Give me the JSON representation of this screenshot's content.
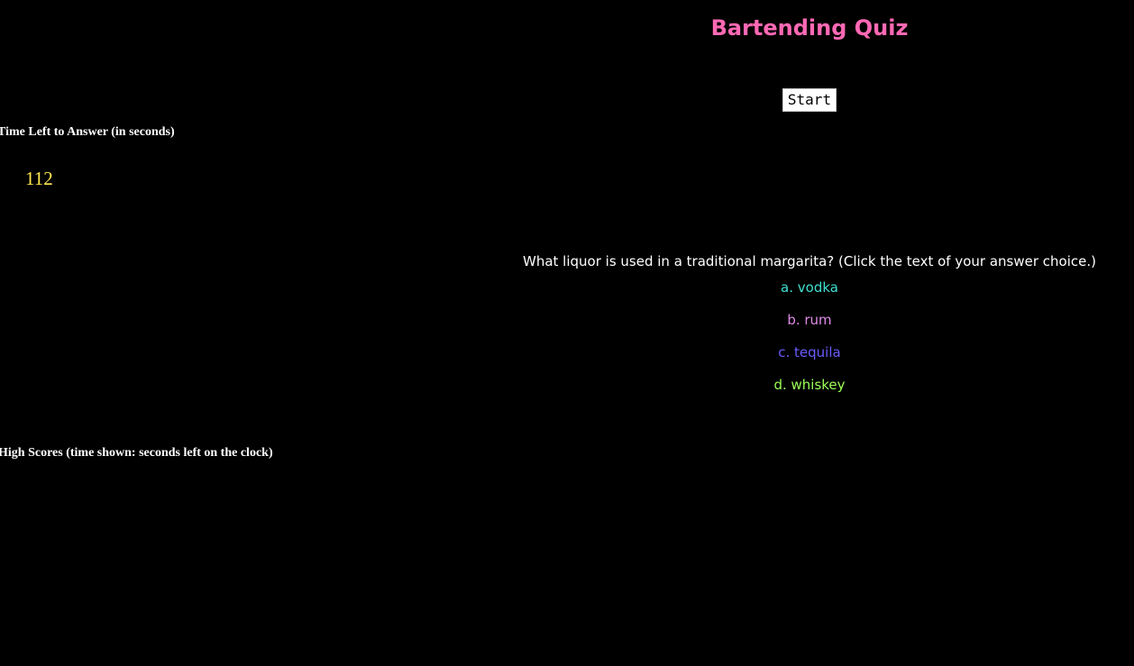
{
  "header": {
    "title": "Bartending Quiz",
    "title_color": "#ff69b4"
  },
  "controls": {
    "start_label": "Start"
  },
  "timer": {
    "heading": "Time Left to Answer (in seconds)",
    "value": "112",
    "value_color": "#ffe94d"
  },
  "question": {
    "text": "What liquor is used in a traditional margarita? (Click the text of your answer choice.)",
    "answers": [
      {
        "label": "a. vodka",
        "color": "#40e0d0"
      },
      {
        "label": "b. rum",
        "color": "#e08ae6"
      },
      {
        "label": "c. tequila",
        "color": "#6a5cff"
      },
      {
        "label": "d. whiskey",
        "color": "#9cff57"
      }
    ]
  },
  "high_scores": {
    "heading": "High Scores (time shown: seconds left on the clock)"
  }
}
